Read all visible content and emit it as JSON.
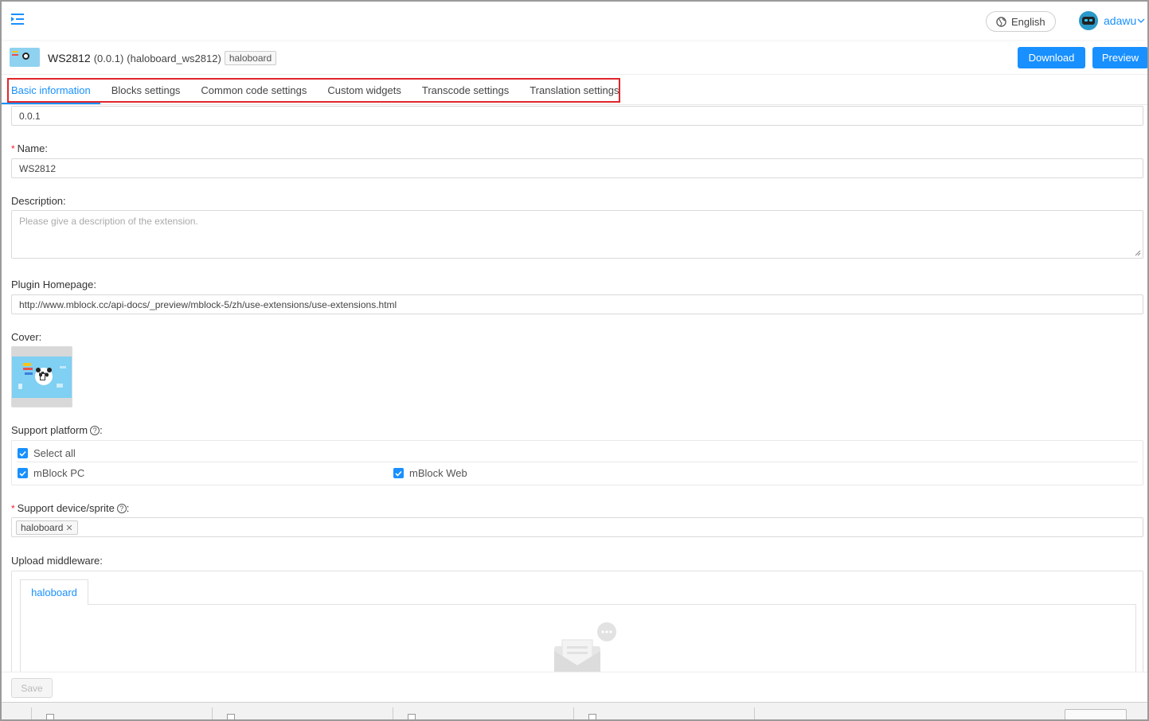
{
  "header": {
    "language": "English",
    "username": "adawu"
  },
  "extension": {
    "name": "WS2812",
    "version": "(0.0.1)",
    "id": "(haloboard_ws2812)",
    "tag": "haloboard"
  },
  "actions": {
    "download": "Download",
    "preview": "Preview"
  },
  "tabs": [
    {
      "label": "Basic information"
    },
    {
      "label": "Blocks settings"
    },
    {
      "label": "Common code settings"
    },
    {
      "label": "Custom widgets"
    },
    {
      "label": "Transcode settings"
    },
    {
      "label": "Translation settings"
    }
  ],
  "form": {
    "version_value": "0.0.1",
    "name_label": "Name:",
    "name_value": "WS2812",
    "description_label": "Description:",
    "description_placeholder": "Please give a description of the extension.",
    "homepage_label": "Plugin Homepage:",
    "homepage_value": "http://www.mblock.cc/api-docs/_preview/mblock-5/zh/use-extensions/use-extensions.html",
    "cover_label": "Cover:",
    "platform_label": "Support platform",
    "select_all": "Select all",
    "platform_pc": "mBlock PC",
    "platform_web": "mBlock Web",
    "device_label": "Support device/sprite",
    "device_chip": "haloboard",
    "middleware_label": "Upload middleware:",
    "middleware_tab": "haloboard",
    "save": "Save",
    "required_mark": "*",
    "help_mark": "?"
  },
  "colors": {
    "accent": "#1890ff",
    "highlight_border": "#e0262b",
    "required": "#f5222d"
  }
}
